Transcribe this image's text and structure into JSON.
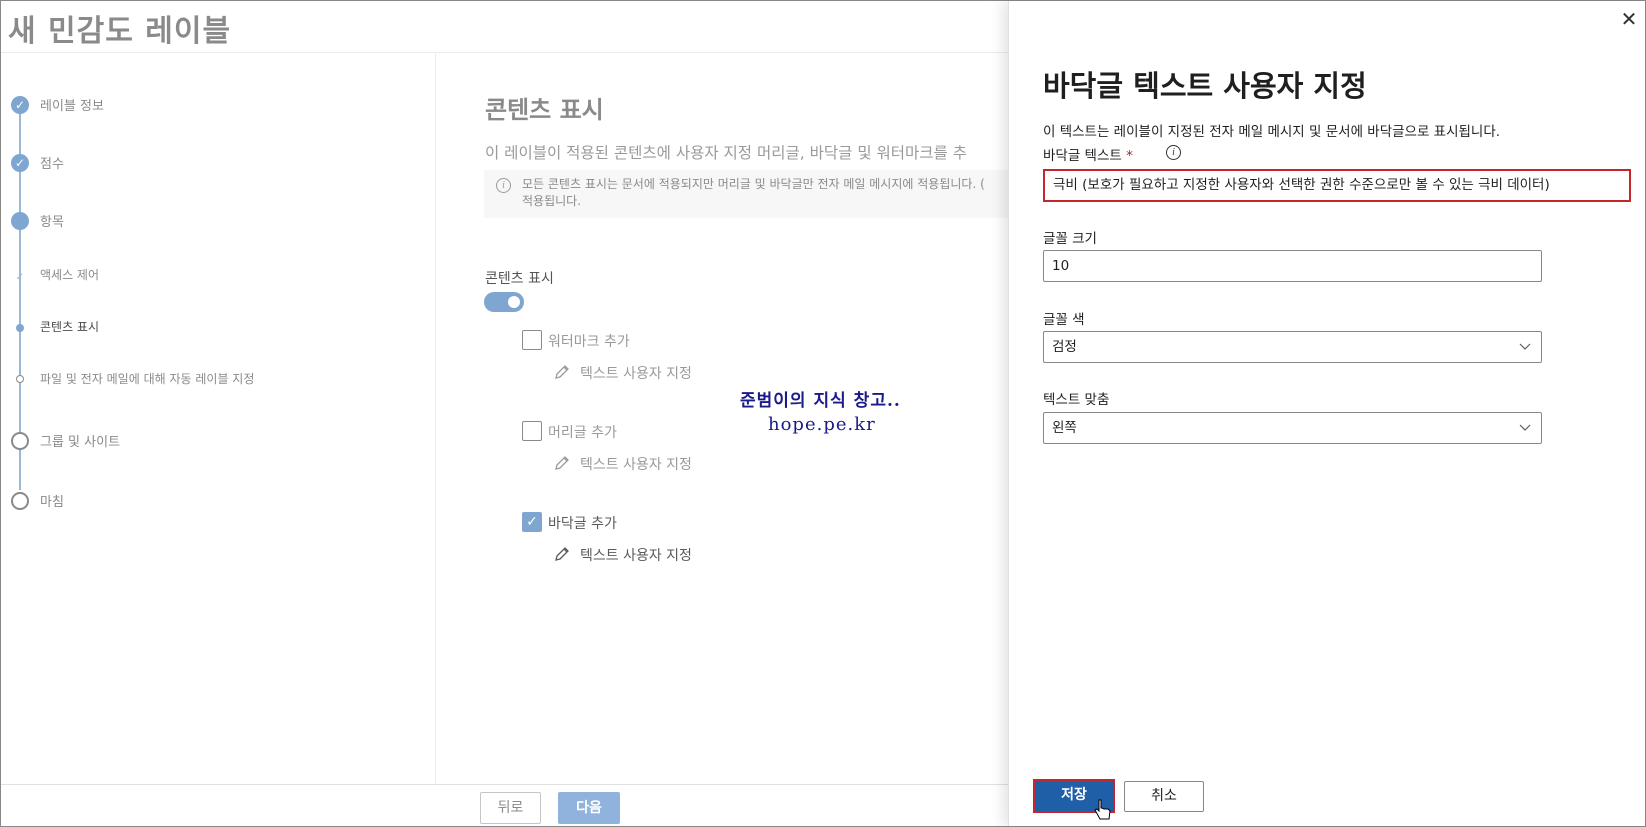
{
  "app": {
    "title": "새 민감도 레이블"
  },
  "stepper": {
    "steps": [
      {
        "label": "레이블 정보",
        "state": "done"
      },
      {
        "label": "점수",
        "state": "done"
      },
      {
        "label": "항목",
        "state": "current"
      },
      {
        "label": "액세스 제어",
        "state": "sub-done"
      },
      {
        "label": "콘텐츠 표시",
        "state": "sub-current"
      },
      {
        "label": "파일 및 전자 메일에 대해 자동 레이블 지정",
        "state": "sub-pending"
      },
      {
        "label": "그룹 및 사이트",
        "state": "pending"
      },
      {
        "label": "마침",
        "state": "pending"
      }
    ]
  },
  "content": {
    "title": "콘텐츠 표시",
    "description": "이 레이블이 적용된 콘텐츠에 사용자 지정 머리글, 바닥글 및 워터마크를 추",
    "info_text": "모든 콘텐츠 표시는 문서에 적용되지만 머리글 및 바닥글만 전자 메일 메시지에 적용됩니다. (\n적용됩니다.",
    "toggle_label": "콘텐츠 표시",
    "toggle_on": true,
    "options": [
      {
        "label": "워터마크 추가",
        "checked": false,
        "custom": "텍스트 사용자 지정"
      },
      {
        "label": "머리글 추가",
        "checked": false,
        "custom": "텍스트 사용자 지정"
      },
      {
        "label": "바닥글 추가",
        "checked": true,
        "custom": "텍스트 사용자 지정"
      }
    ],
    "watermark": {
      "line1": "준범이의 지식 창고..",
      "line2": "hope.pe.kr"
    },
    "back_label": "뒤로",
    "next_label": "다음"
  },
  "panel": {
    "title": "바닥글 텍스트 사용자 지정",
    "description": "이 텍스트는 레이블이 지정된 전자 메일 메시지 및 문서에 바닥글으로 표시됩니다.",
    "footer_text_label": "바닥글 텍스트",
    "required_mark": "*",
    "footer_text_value": "극비 (보호가 필요하고 지정한 사용자와 선택한 권한 수준으로만 볼 수 있는 극비 데이터)",
    "font_size_label": "글꼴 크기",
    "font_size_value": "10",
    "font_color_label": "글꼴 색",
    "font_color_value": "검정",
    "align_label": "텍스트 맞춤",
    "align_value": "왼쪽",
    "save_label": "저장",
    "cancel_label": "취소"
  },
  "colors": {
    "accent": "#1e5fa8",
    "highlight_border": "#c4262e",
    "dim_accent": "#7fa6d0"
  }
}
